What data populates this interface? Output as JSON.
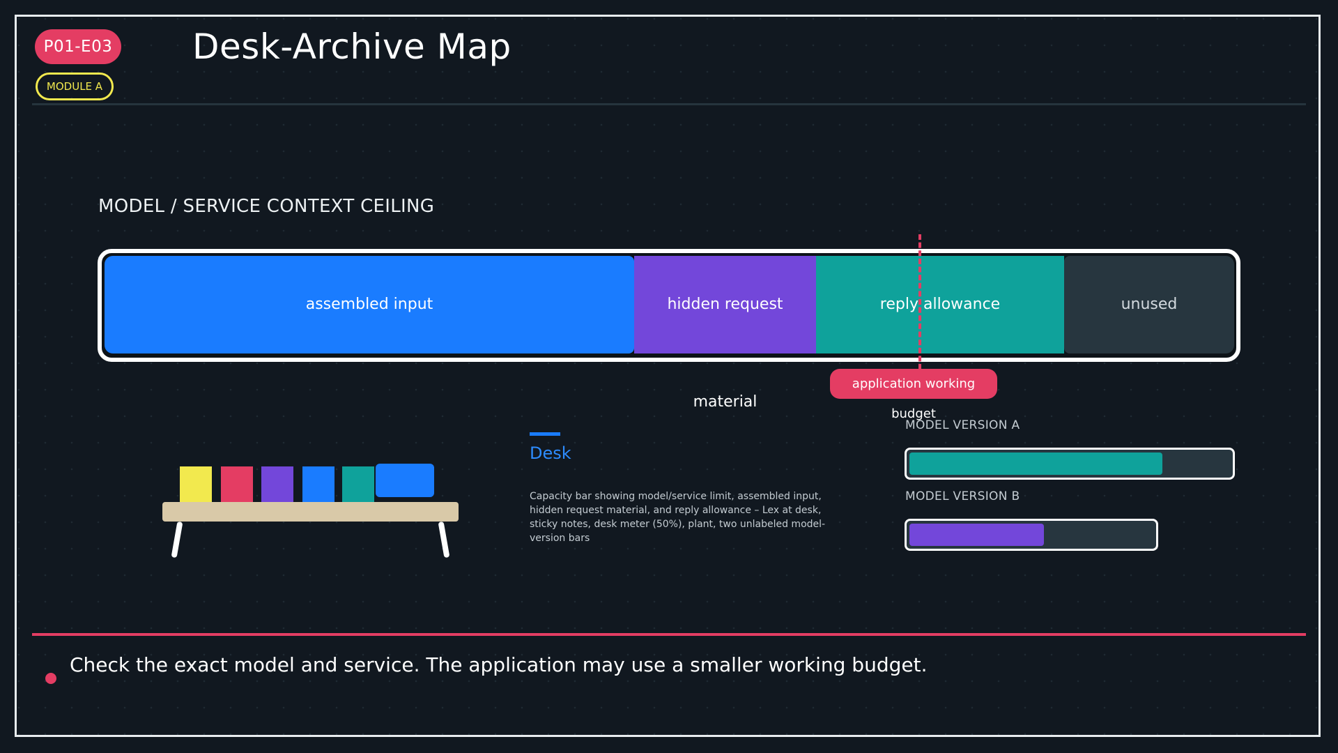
{
  "header": {
    "episode_code": "P01-E03",
    "module": "MODULE A",
    "title": "Desk-Archive Map"
  },
  "ceiling": {
    "label": "MODEL / SERVICE CONTEXT CEILING",
    "segments": [
      {
        "label": "assembled input",
        "color": "#1a7cff"
      },
      {
        "label": "hidden request material",
        "color": "#7347da"
      },
      {
        "label": "reply allowance",
        "color": "#0fa29b"
      },
      {
        "label": "unused",
        "color": "#27363f"
      }
    ],
    "budget_marker": "application working budget"
  },
  "desk": {
    "title": "Desk",
    "description": "Capacity bar showing model/service limit, assembled input, hidden request material, and reply allowance – Lex at desk, sticky notes, desk meter (50%), plant, two unlabeled model-version bars",
    "note_colors": [
      "#f2e94e",
      "#e43d63",
      "#7347da",
      "#1a7cff",
      "#0fa29b"
    ]
  },
  "model_versions": [
    {
      "label": "MODEL VERSION A",
      "fill_fraction": 0.79,
      "color": "#0fa29b"
    },
    {
      "label": "MODEL VERSION B",
      "fill_fraction": 0.55,
      "color": "#7347da"
    }
  ],
  "footer": {
    "text": "Check the exact model and service. The application may use a smaller working budget."
  },
  "colors": {
    "background": "#111820",
    "accent_red": "#e43d63",
    "accent_yellow": "#f2e94e"
  }
}
